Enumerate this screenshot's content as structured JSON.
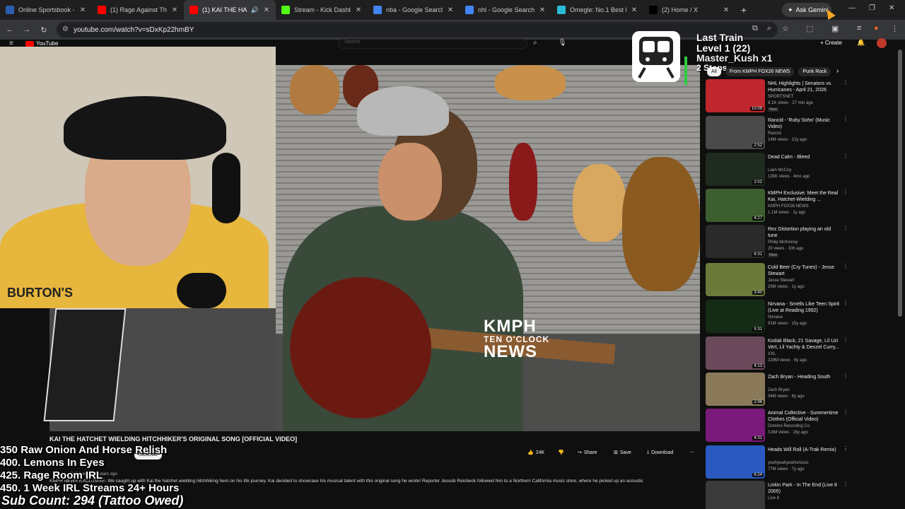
{
  "browser": {
    "tabs": [
      {
        "title": "Online Sportsbook - Re",
        "color": "#2a5db0",
        "active": false
      },
      {
        "title": "(1) Rage Against Th",
        "color": "#ff0000",
        "active": false
      },
      {
        "title": "(1) KAI THE HATCH",
        "color": "#ff0000",
        "active": true
      },
      {
        "title": "Stream - Kick Dashboa",
        "color": "#53fc18",
        "active": false
      },
      {
        "title": "nba - Google Search",
        "color": "#4285f4",
        "active": false
      },
      {
        "title": "nhl - Google Search",
        "color": "#4285f4",
        "active": false
      },
      {
        "title": "Omegle: No.1 Best Ran",
        "color": "#2bbbd8",
        "active": false
      },
      {
        "title": "(2) Home / X",
        "color": "#000000",
        "active": false
      }
    ],
    "gemini_label": "Ask Gemini",
    "url": "youtube.com/watch?v=sDxKp22hmBY"
  },
  "youtube": {
    "logo_text": "YouTube",
    "search_placeholder": "Search",
    "create_label": "Create",
    "chips": [
      "All",
      "From KMPH FOX26 NEWS",
      "Punk Rock"
    ],
    "video_title": "KAI THE HATCHET WIELDING HITCHHIKER'S ORIGINAL SONG [OFFICIAL VIDEO]",
    "subscribe_label": "Subscribe",
    "likes": "24K",
    "share_label": "Share",
    "save_label": "Save",
    "download_label": "Download",
    "description_meta": "2.8M views  11 years ago",
    "description": "KMPH NEWS EXCLUSIVE- We caught up with Kai the hatchet wielding hitchhiking hero on his life journey. Kai decided to showcase his musical talent with this original song he wrote! Reporter Jessob Reisbeck followed him to a Northern California music store, where he picked up an acoustic",
    "watermark": {
      "line1": "KMPH",
      "line2": "TEN O'CLOCK",
      "line3": "NEWS"
    }
  },
  "stream_overlay": {
    "train": {
      "title": "Last Train",
      "level": "Level 1  (22)",
      "name": "Master_Kush x1",
      "stops": "2 Stops"
    },
    "shirt_text": "BURTON'S",
    "goals": [
      "350 Raw Onion And Horse Relish",
      "400. Lemons In Eyes",
      "425. Rage Room IRL",
      "450. 1 Week IRL Streams 24+ Hours"
    ],
    "sub_count": "Sub Count: 294 (Tattoo Owed)"
  },
  "recommendations": [
    {
      "title": "NHL Highlights | Senators vs. Hurricanes - April 21, 2026",
      "channel": "SPORTSNET",
      "meta": "8.1K views · 27 min ago",
      "badge": "New",
      "duration": "10:09",
      "thumb": "#c0262d"
    },
    {
      "title": "Rancid - 'Ruby Soho' (Music Video)",
      "channel": "Rancid",
      "meta": "14M views · 12y ago",
      "badge": "",
      "duration": "2:52",
      "thumb": "#4a4a4a"
    },
    {
      "title": "Dead Calm - Bleed",
      "channel": "Liam McCoy",
      "meta": "135K views · 4mo ago",
      "badge": "",
      "duration": "2:02",
      "thumb": "#1e2b1e"
    },
    {
      "title": "KMPH Exclusive: Meet the Real Kai, Hatchet-Wielding ...",
      "channel": "KMPH FOX26 NEWS",
      "meta": "1.1M views · 1y ago",
      "badge": "",
      "duration": "4:27",
      "thumb": "#3d5e2e"
    },
    {
      "title": "Rez Distortion playing an old tune",
      "channel": "Philip McKinney",
      "meta": "20 views · 10h ago",
      "badge": "New",
      "duration": "6:31",
      "thumb": "#2a2a2a"
    },
    {
      "title": "Cold Beer (Cry Tunes) - Jesse Stewart",
      "channel": "Jesse Stewart",
      "meta": "20M views · 1y ago",
      "badge": "",
      "duration": "3:40",
      "thumb": "#6b7a3a"
    },
    {
      "title": "Nirvana - Smells Like Teen Spirit (Live at Reading 1992)",
      "channel": "Nirvana",
      "meta": "91M views · 15y ago",
      "badge": "",
      "duration": "5:31",
      "thumb": "#152b15"
    },
    {
      "title": "Kodak Black, 21 Savage, Lil Uzi Vert, Lil Yachty & Denzel Curry...",
      "channel": "XXL",
      "meta": "229M views · 9y ago",
      "badge": "",
      "duration": "4:13",
      "thumb": "#6a4a5a"
    },
    {
      "title": "Zach Bryan - Heading South",
      "channel": "Zach Bryan",
      "meta": "34M views · 8y ago",
      "badge": "",
      "duration": "2:46",
      "thumb": "#8a7a5a"
    },
    {
      "title": "Animal Collective - Summertime Clothes (Official Video)",
      "channel": "Domino Recording Co.",
      "meta": "3.8M views · 16y ago",
      "badge": "",
      "duration": "4:31",
      "thumb": "#7a1a7a"
    },
    {
      "title": "Heads Will Roll (A-Trak Remix)",
      "channel": "yeahyeahyeahsmusic",
      "meta": "77M views · 7y ago",
      "badge": "",
      "duration": "6:24",
      "thumb": "#2a5ac0"
    },
    {
      "title": "Linkin Park - In The End (Live 8 2005)",
      "channel": "Live 8",
      "meta": "",
      "badge": "",
      "duration": "",
      "thumb": "#3a3a3a"
    }
  ]
}
